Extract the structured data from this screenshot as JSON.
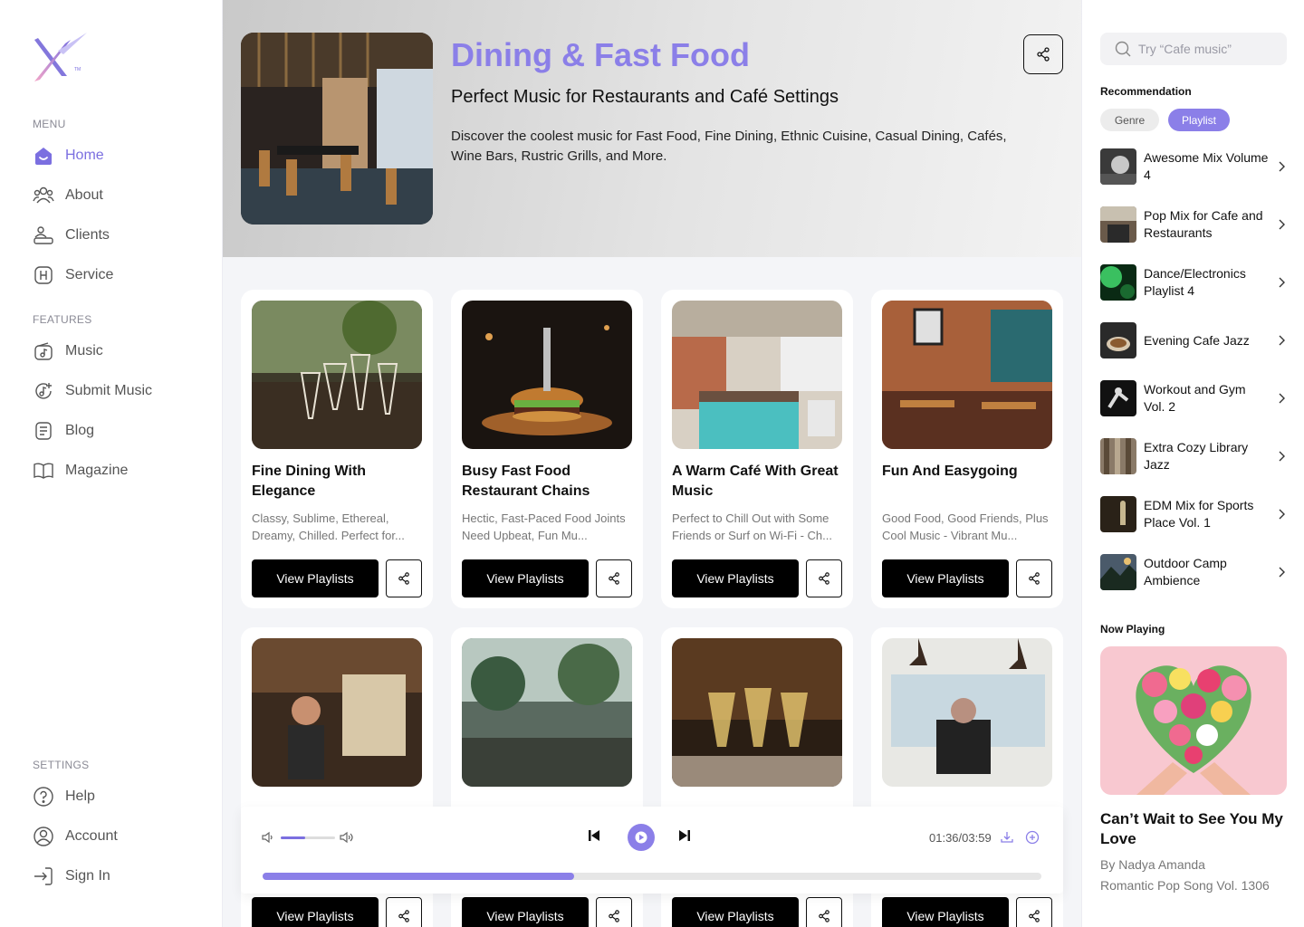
{
  "sidebar": {
    "menu_label": "MENU",
    "features_label": "FEATURES",
    "settings_label": "SETTINGS",
    "menu": [
      {
        "label": "Home",
        "icon": "home-icon",
        "active": true
      },
      {
        "label": "About",
        "icon": "users-icon"
      },
      {
        "label": "Clients",
        "icon": "clients-icon"
      },
      {
        "label": "Service",
        "icon": "service-icon"
      }
    ],
    "features": [
      {
        "label": "Music",
        "icon": "music-icon"
      },
      {
        "label": "Submit Music",
        "icon": "submit-music-icon"
      },
      {
        "label": "Blog",
        "icon": "blog-icon"
      },
      {
        "label": "Magazine",
        "icon": "book-icon"
      }
    ],
    "settings": [
      {
        "label": "Help",
        "icon": "help-icon"
      },
      {
        "label": "Account",
        "icon": "account-icon"
      },
      {
        "label": "Sign In",
        "icon": "sign-in-icon"
      }
    ]
  },
  "hero": {
    "title": "Dining & Fast Food",
    "subtitle": "Perfect Music for Restaurants and Café Settings",
    "description": "Discover the coolest music for Fast Food, Fine Dining, Ethnic Cuisine, Casual Dining, Cafés, Wine Bars, Rustric Grills, and More."
  },
  "cards": [
    {
      "title": "Fine Dining With Elegance",
      "desc": "Classy, Sublime, Ethereal, Dreamy, Chilled. Perfect for...",
      "button": "View Playlists"
    },
    {
      "title": "Busy Fast Food Restaurant Chains",
      "desc": "Hectic, Fast-Paced Food Joints Need Upbeat, Fun Mu...",
      "button": "View Playlists"
    },
    {
      "title": "A Warm Café With Great Music",
      "desc": "Perfect to Chill Out with Some Friends or Surf on Wi-Fi - Ch...",
      "button": "View Playlists"
    },
    {
      "title": "Fun And Easygoing",
      "desc": "Good Food, Good Friends, Plus Cool Music - Vibrant Mu...",
      "button": "View Playlists"
    }
  ],
  "cards_row2_button": "View Playlists",
  "player": {
    "time": "01:36/03:59",
    "volume": 0.45,
    "progress": 0.4
  },
  "search": {
    "placeholder": "Try “Cafe music”"
  },
  "recommendation": {
    "heading": "Recommendation",
    "chips": [
      "Genre",
      "Playlist"
    ],
    "active_chip": "Playlist",
    "items": [
      {
        "title": "Awesome Mix Volume 4"
      },
      {
        "title": "Pop Mix for Cafe and Restaurants"
      },
      {
        "title": "Dance/Electronics Playlist 4"
      },
      {
        "title": "Evening Cafe Jazz"
      },
      {
        "title": "Workout and Gym Vol. 2"
      },
      {
        "title": "Extra Cozy Library Jazz"
      },
      {
        "title": "EDM Mix for Sports Place Vol. 1"
      },
      {
        "title": "Outdoor Camp Ambience"
      }
    ]
  },
  "now_playing": {
    "heading": "Now Playing",
    "title": "Can’t Wait to See You My Love",
    "artist": "By Nadya Amanda",
    "album": "Romantic Pop Song Vol. 1306"
  },
  "colors": {
    "accent": "#8b7fe8",
    "active_nav": "#7b6fe0"
  }
}
